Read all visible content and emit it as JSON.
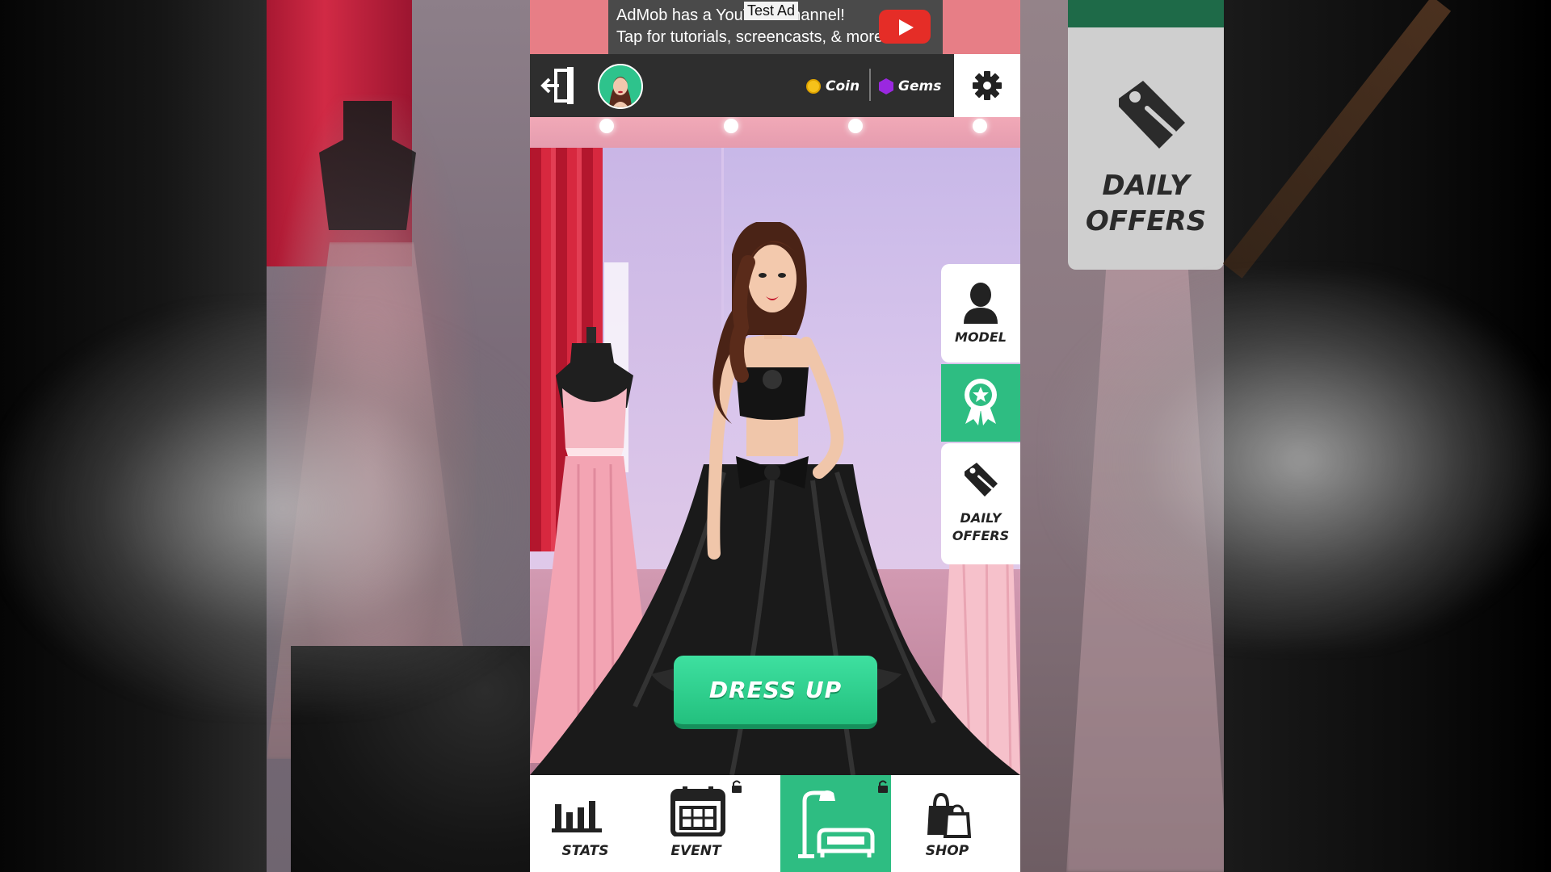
{
  "ad": {
    "line1": "AdMob has a YouTube channel!",
    "line2": "Tap for tutorials, screencasts, & more.",
    "label": "Test Ad"
  },
  "topbar": {
    "coin_label": "Coin",
    "gems_label": "Gems"
  },
  "side_menu": {
    "model_label": "MODEL",
    "offers_line1": "DAILY",
    "offers_line2": "OFFERS"
  },
  "background_card": {
    "line1": "DAILY",
    "line2": "OFFERS"
  },
  "main": {
    "dress_up_label": "DRESS UP"
  },
  "bottom_nav": {
    "stats_label": "STATS",
    "event_label": "EVENT",
    "shop_label": "SHOP"
  },
  "colors": {
    "accent_green": "#2ebd82",
    "topbar": "#2e2e2e",
    "ad_red": "#e52d27"
  }
}
